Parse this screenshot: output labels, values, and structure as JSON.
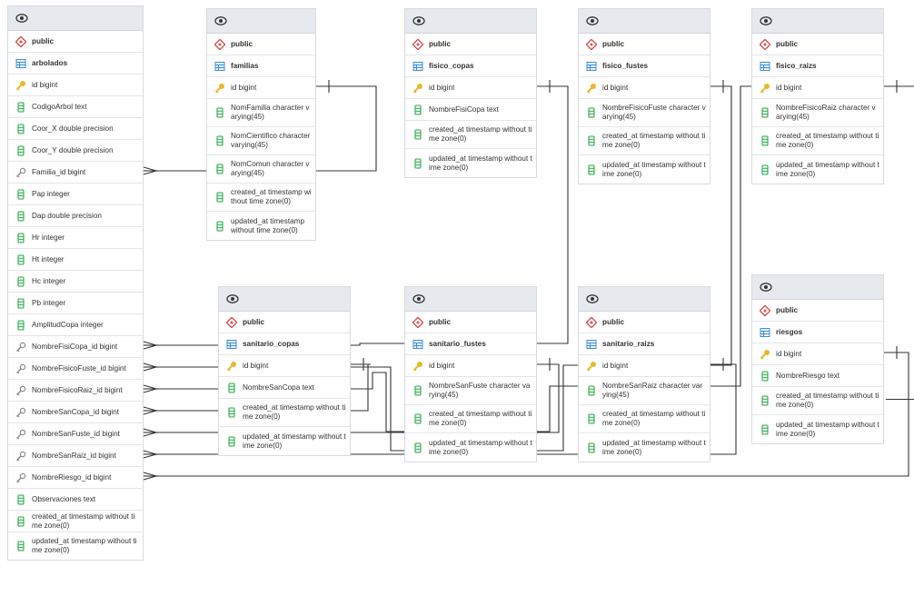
{
  "schema": "public",
  "tables": [
    {
      "id": "arbolados",
      "name": "arbolados",
      "columns": [
        {
          "text": "id bigint",
          "kind": "pk"
        },
        {
          "text": "CodigoArbol text",
          "kind": "col"
        },
        {
          "text": "Coor_X double precision",
          "kind": "col"
        },
        {
          "text": "Coor_Y double precision",
          "kind": "col"
        },
        {
          "text": "Familia_id bigint",
          "kind": "fk"
        },
        {
          "text": "Pap integer",
          "kind": "col"
        },
        {
          "text": "Dap double precision",
          "kind": "col"
        },
        {
          "text": "Hr integer",
          "kind": "col"
        },
        {
          "text": "Ht integer",
          "kind": "col"
        },
        {
          "text": "Hc integer",
          "kind": "col"
        },
        {
          "text": "Pb integer",
          "kind": "col"
        },
        {
          "text": "AmplitudCopa integer",
          "kind": "col"
        },
        {
          "text": "NombreFisiCopa_id bigint",
          "kind": "fk"
        },
        {
          "text": "NombreFisicoFuste_id bigint",
          "kind": "fk"
        },
        {
          "text": "NombreFisicoRaiz_id bigint",
          "kind": "fk"
        },
        {
          "text": "NombreSanCopa_id bigint",
          "kind": "fk"
        },
        {
          "text": "NombreSanFuste_id bigint",
          "kind": "fk"
        },
        {
          "text": "NombreSanRaiz_id bigint",
          "kind": "fk"
        },
        {
          "text": "NombreRiesgo_id bigint",
          "kind": "fk"
        },
        {
          "text": "Observaciones text",
          "kind": "col"
        },
        {
          "text": "created_at timestamp without time zone(0)",
          "kind": "col"
        },
        {
          "text": "updated_at timestamp without time zone(0)",
          "kind": "col"
        }
      ]
    },
    {
      "id": "familias",
      "name": "familias",
      "columns": [
        {
          "text": "id bigint",
          "kind": "pk"
        },
        {
          "text": "NomFamilia character varying(45)",
          "kind": "col"
        },
        {
          "text": "NomCientifico character varying(45)",
          "kind": "col"
        },
        {
          "text": "NomComun character varying(45)",
          "kind": "col"
        },
        {
          "text": "created_at timestamp without time zone(0)",
          "kind": "col"
        },
        {
          "text": "updated_at timestamp without time zone(0)",
          "kind": "col"
        }
      ]
    },
    {
      "id": "fisico_copas",
      "name": "fisico_copas",
      "columns": [
        {
          "text": "id bigint",
          "kind": "pk"
        },
        {
          "text": "NombreFisiCopa text",
          "kind": "col"
        },
        {
          "text": "created_at timestamp without time zone(0)",
          "kind": "col"
        },
        {
          "text": "updated_at timestamp without time zone(0)",
          "kind": "col"
        }
      ]
    },
    {
      "id": "fisico_fustes",
      "name": "fisico_fustes",
      "columns": [
        {
          "text": "id bigint",
          "kind": "pk"
        },
        {
          "text": "NombreFisicoFuste character varying(45)",
          "kind": "col"
        },
        {
          "text": "created_at timestamp without time zone(0)",
          "kind": "col"
        },
        {
          "text": "updated_at timestamp without time zone(0)",
          "kind": "col"
        }
      ]
    },
    {
      "id": "fisico_raizs",
      "name": "fisico_raizs",
      "columns": [
        {
          "text": "id bigint",
          "kind": "pk"
        },
        {
          "text": "NombreFisicoRaiz character varying(45)",
          "kind": "col"
        },
        {
          "text": "created_at timestamp without time zone(0)",
          "kind": "col"
        },
        {
          "text": "updated_at timestamp without time zone(0)",
          "kind": "col"
        }
      ]
    },
    {
      "id": "sanitario_copas",
      "name": "sanitario_copas",
      "columns": [
        {
          "text": "id bigint",
          "kind": "pk"
        },
        {
          "text": "NombreSanCopa text",
          "kind": "col"
        },
        {
          "text": "created_at timestamp without time zone(0)",
          "kind": "col"
        },
        {
          "text": "updated_at timestamp without time zone(0)",
          "kind": "col"
        }
      ]
    },
    {
      "id": "sanitario_fustes",
      "name": "sanitario_fustes",
      "columns": [
        {
          "text": "id bigint",
          "kind": "pk"
        },
        {
          "text": "NombreSanFuste character varying(45)",
          "kind": "col"
        },
        {
          "text": "created_at timestamp without time zone(0)",
          "kind": "col"
        },
        {
          "text": "updated_at timestamp without time zone(0)",
          "kind": "col"
        }
      ]
    },
    {
      "id": "sanitario_raizs",
      "name": "sanitario_raizs",
      "columns": [
        {
          "text": "id bigint",
          "kind": "pk"
        },
        {
          "text": "NombreSanRaiz character varying(45)",
          "kind": "col"
        },
        {
          "text": "created_at timestamp without time zone(0)",
          "kind": "col"
        },
        {
          "text": "updated_at timestamp without time zone(0)",
          "kind": "col"
        }
      ]
    },
    {
      "id": "riesgos",
      "name": "riesgos",
      "columns": [
        {
          "text": "id bigint",
          "kind": "pk"
        },
        {
          "text": "NombreRiesgo text",
          "kind": "col"
        },
        {
          "text": "created_at timestamp without time zone(0)",
          "kind": "col"
        },
        {
          "text": "updated_at timestamp without time zone(0)",
          "kind": "col"
        }
      ]
    }
  ],
  "relations": [
    {
      "from": "arbolados",
      "col": "Familia_id bigint",
      "to": "familias"
    },
    {
      "from": "arbolados",
      "col": "NombreFisiCopa_id bigint",
      "to": "fisico_copas"
    },
    {
      "from": "arbolados",
      "col": "NombreFisicoFuste_id bigint",
      "to": "fisico_fustes"
    },
    {
      "from": "arbolados",
      "col": "NombreFisicoRaiz_id bigint",
      "to": "fisico_raizs"
    },
    {
      "from": "arbolados",
      "col": "NombreSanCopa_id bigint",
      "to": "sanitario_copas"
    },
    {
      "from": "arbolados",
      "col": "NombreSanFuste_id bigint",
      "to": "sanitario_fustes"
    },
    {
      "from": "arbolados",
      "col": "NombreSanRaiz_id bigint",
      "to": "sanitario_raizs"
    },
    {
      "from": "arbolados",
      "col": "NombreRiesgo_id bigint",
      "to": "riesgos"
    }
  ],
  "icons": {
    "eye": "eye-icon",
    "schema": "schema-icon",
    "table": "table-icon",
    "pk": "key-icon",
    "fk": "foreign-key-icon",
    "col": "column-icon"
  },
  "colors": {
    "header": "#e6e9ee",
    "schema": "#d9534f",
    "table": "#3d8fd6",
    "key": "#e9b82c",
    "column": "#2fa84f"
  }
}
